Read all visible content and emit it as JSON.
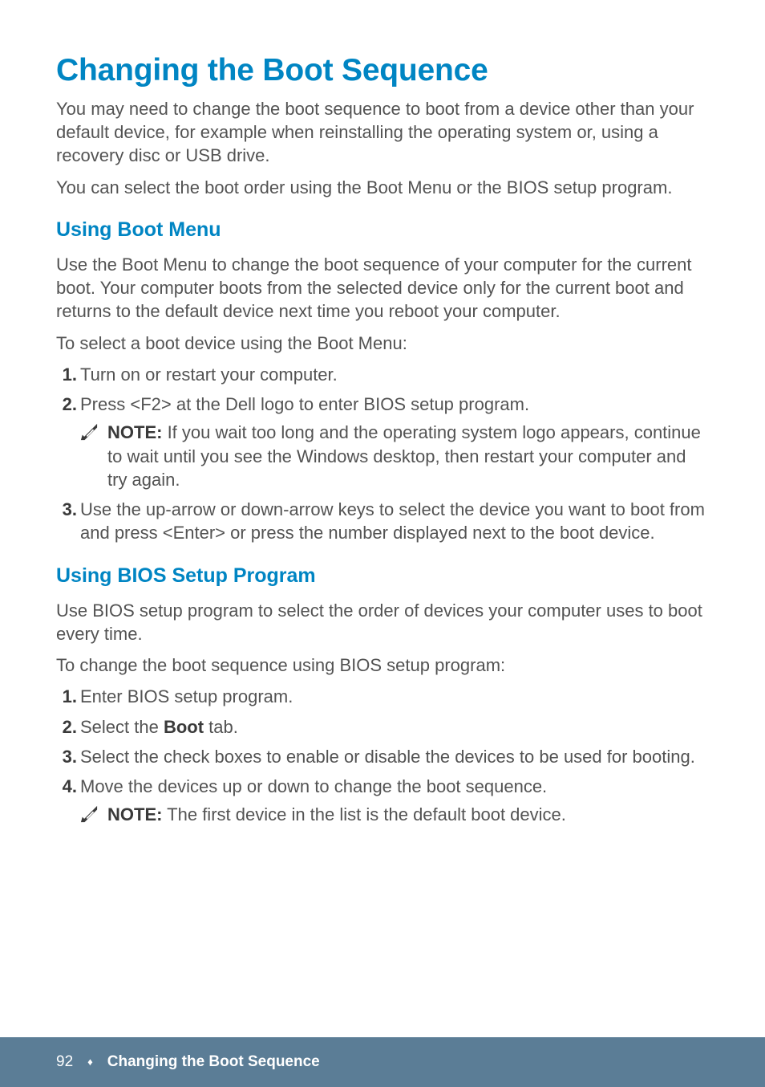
{
  "heading": "Changing the Boot Sequence",
  "intro_p1": "You may need to change the boot sequence to boot from a device other than your default device, for example when reinstalling the operating system or, using a recovery disc or USB drive.",
  "intro_p2": "You can select the boot order using the Boot Menu or the BIOS setup program.",
  "bootmenu": {
    "heading": "Using Boot Menu",
    "p1": "Use the Boot Menu to change the boot sequence of your computer for the current boot. Your computer boots from the selected device only for the current boot and returns to the default device next time you reboot your computer.",
    "p2": "To select a boot device using the Boot Menu:",
    "steps": {
      "s1": {
        "marker": "1.",
        "text": "Turn on or restart your computer."
      },
      "s2": {
        "marker": "2.",
        "text": "Press <F2> at the Dell logo to enter BIOS setup program."
      },
      "s2_note": {
        "label": "NOTE:",
        "text": " If you wait too long and the operating system logo appears, continue to wait until you see the Windows desktop, then restart your computer and try again."
      },
      "s3": {
        "marker": "3.",
        "text": "Use the up-arrow or down-arrow keys to select the device you want to boot from and press <Enter> or press the number displayed next to the boot device."
      }
    }
  },
  "biossetup": {
    "heading": "Using BIOS Setup Program",
    "p1": "Use BIOS setup program to select the order of devices your computer uses to boot every time.",
    "p2": "To change the boot sequence using BIOS setup program:",
    "steps": {
      "s1": {
        "marker": "1.",
        "text": "Enter BIOS setup program."
      },
      "s2": {
        "marker": "2.",
        "pre": "Select the ",
        "bold": "Boot",
        "post": " tab."
      },
      "s3": {
        "marker": "3.",
        "text": "Select the check boxes to enable or disable the devices to be used for booting."
      },
      "s4": {
        "marker": "4.",
        "text": "Move the devices up or down to change the boot sequence."
      },
      "s4_note": {
        "label": "NOTE:",
        "text": " The first device in the list is the default boot device."
      }
    }
  },
  "footer": {
    "page": "92",
    "diamond": "♦",
    "section": "Changing the Boot Sequence"
  }
}
